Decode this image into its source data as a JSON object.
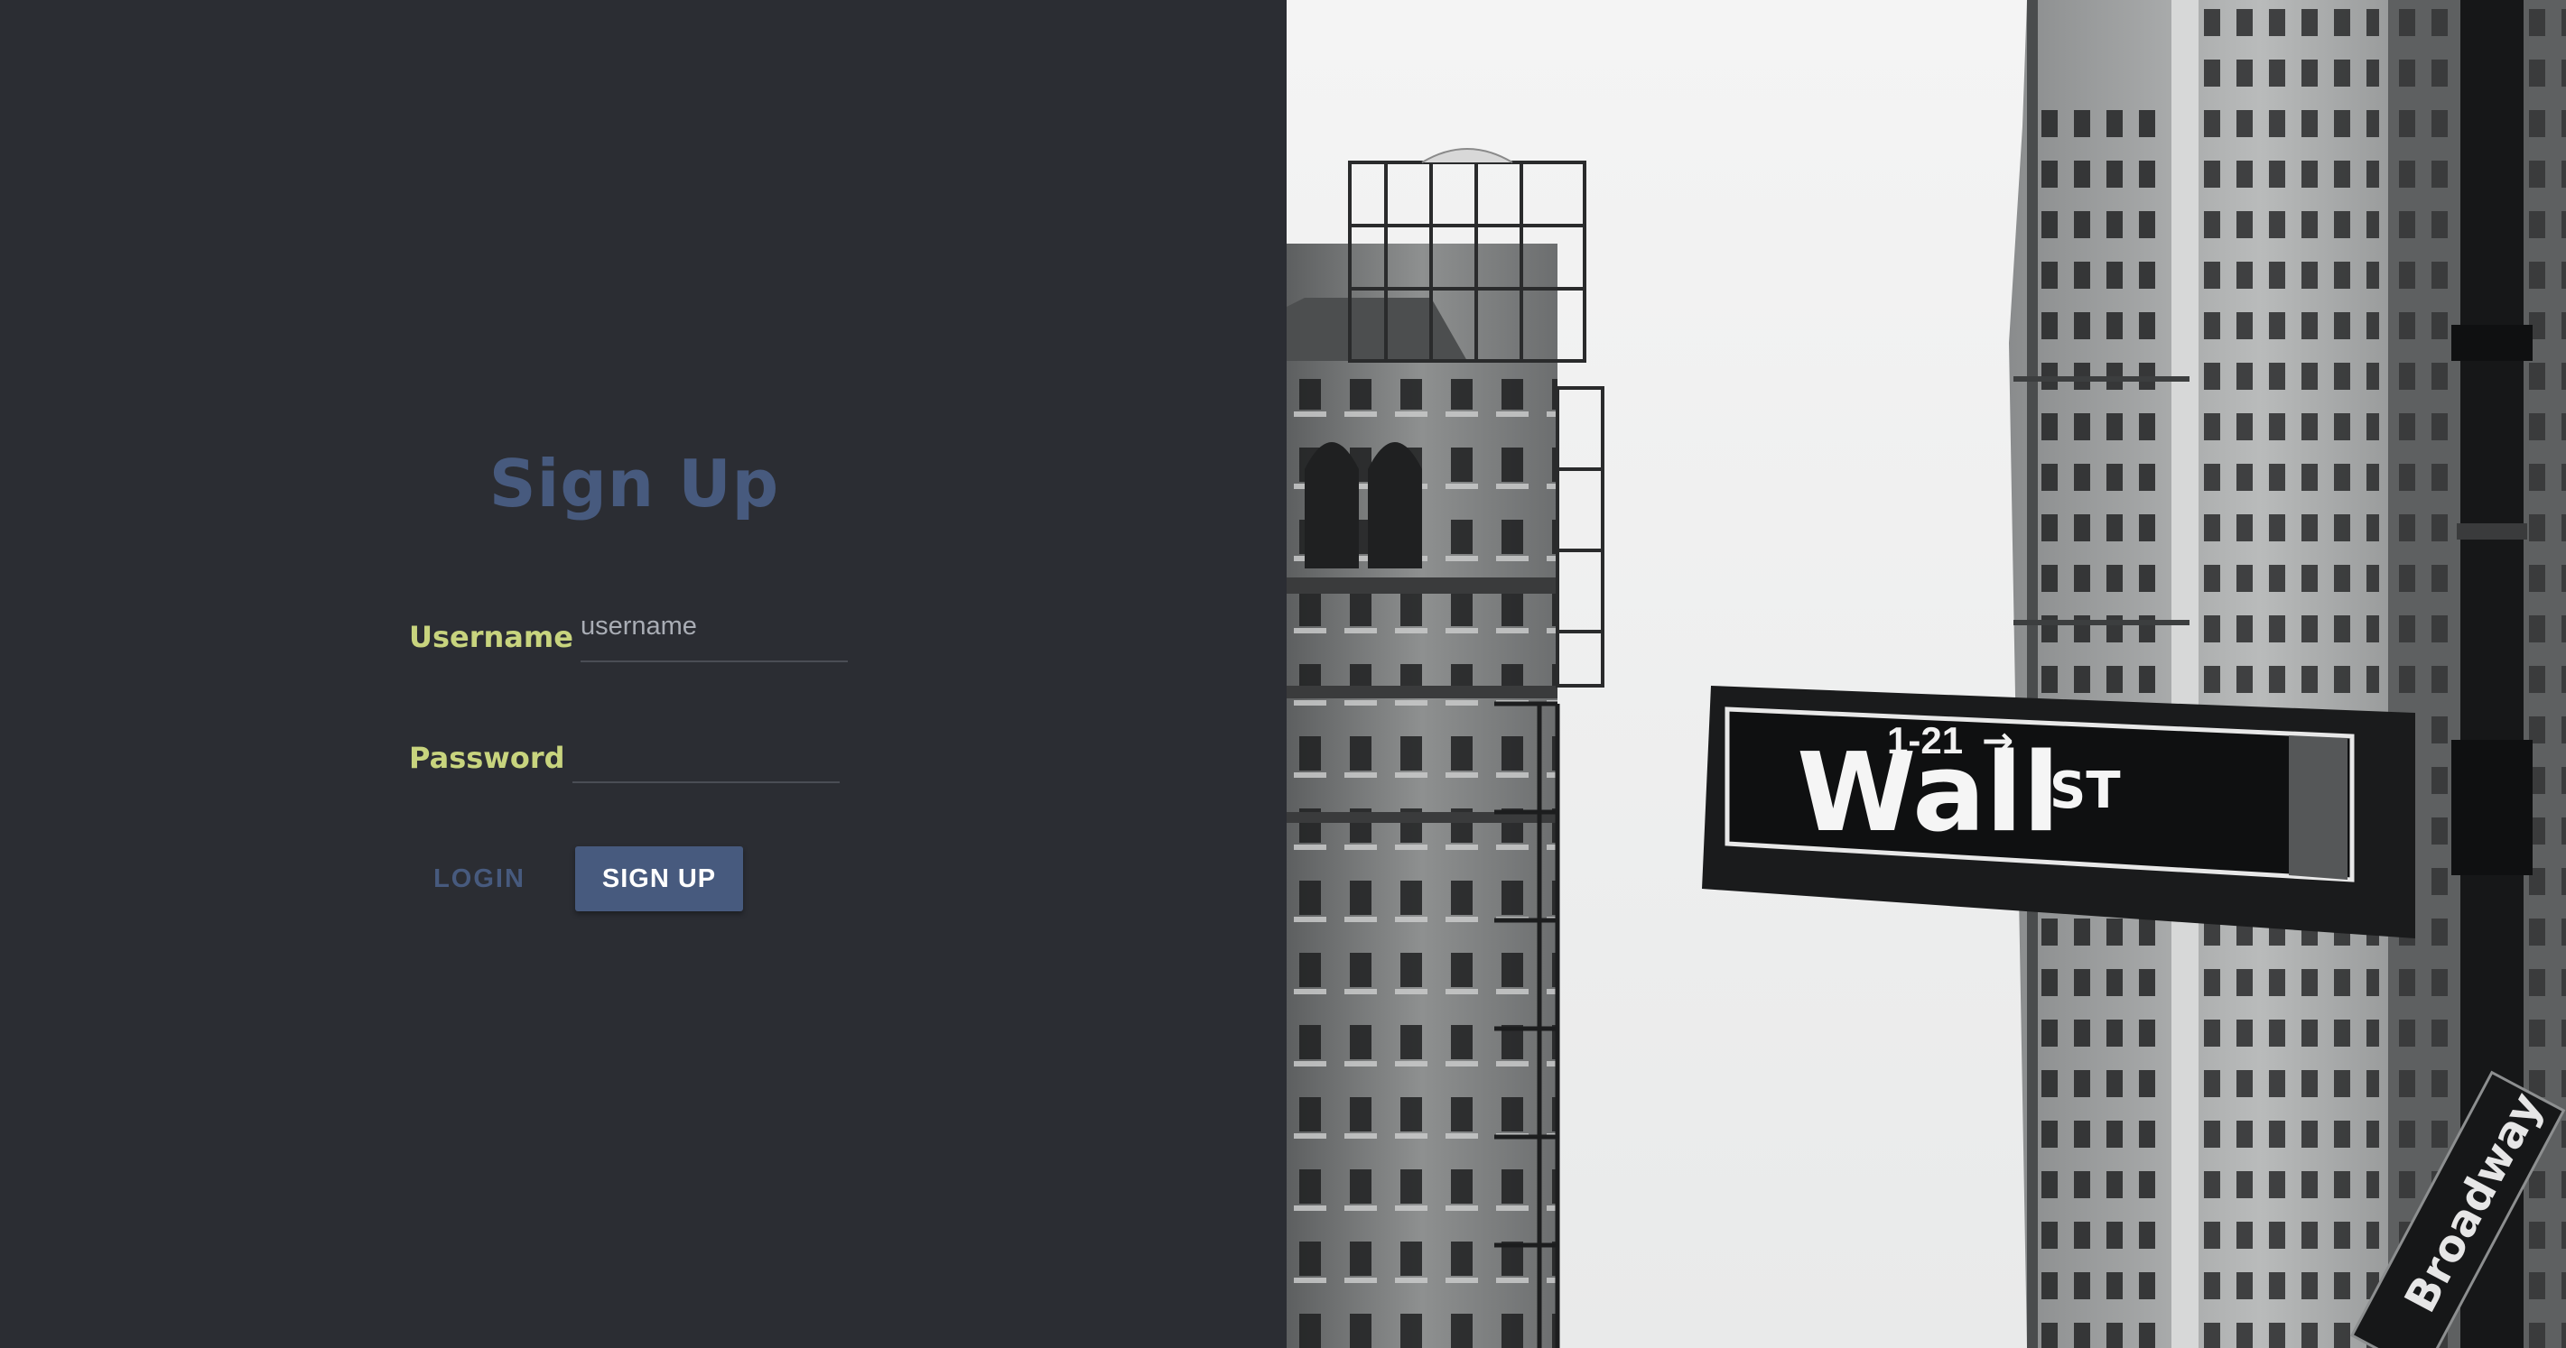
{
  "form": {
    "title": "Sign Up",
    "username_label": "Username",
    "username_placeholder": "username",
    "username_value": "",
    "password_label": "Password",
    "password_value": "",
    "login_label": "LOGIN",
    "signup_label": "SIGN UP"
  },
  "photo": {
    "sign_number": "1-21",
    "sign_arrow": "→",
    "sign_street": "Wall",
    "sign_suffix": "ST",
    "second_sign_text": "Broadway"
  },
  "colors": {
    "background": "#2b2d33",
    "accent": "#475a7e",
    "label": "#c8d47e"
  }
}
